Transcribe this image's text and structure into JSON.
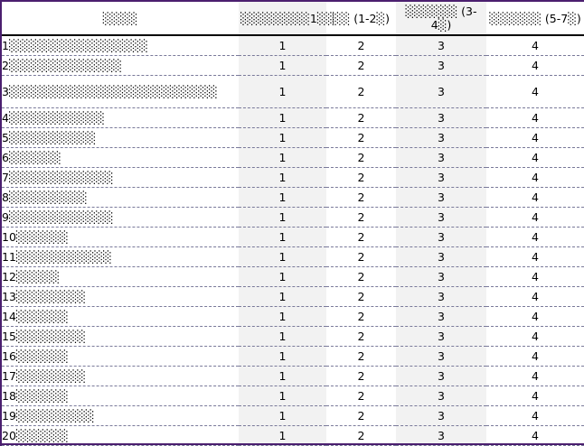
{
  "table": {
    "headers": [
      "░░░░",
      "░░░░░░░░1░░",
      "░░ (1-2░)",
      "░░░░░░ (3-4░)",
      "░░░░░░ (5-7░)"
    ],
    "rows": [
      {
        "label": "1░░░░░░░░░░░░░░░░",
        "values": [
          "1",
          "2",
          "3",
          "4"
        ]
      },
      {
        "label": "2░░░░░░░░░░░░░",
        "values": [
          "1",
          "2",
          "3",
          "4"
        ]
      },
      {
        "label": "3░░░░░░░░░░░░░░░░░░░░░░░░",
        "values": [
          "1",
          "2",
          "3",
          "4"
        ]
      },
      {
        "label": "4░░░░░░░░░░░",
        "values": [
          "1",
          "2",
          "3",
          "4"
        ]
      },
      {
        "label": "5░░░░░░░░░░",
        "values": [
          "1",
          "2",
          "3",
          "4"
        ]
      },
      {
        "label": "6░░░░░░",
        "values": [
          "1",
          "2",
          "3",
          "4"
        ]
      },
      {
        "label": "7░░░░░░░░░░░░",
        "values": [
          "1",
          "2",
          "3",
          "4"
        ]
      },
      {
        "label": "8░░░░░░░░░",
        "values": [
          "1",
          "2",
          "3",
          "4"
        ]
      },
      {
        "label": "9░░░░░░░░░░░░",
        "values": [
          "1",
          "2",
          "3",
          "4"
        ]
      },
      {
        "label": "10░░░░░░",
        "values": [
          "1",
          "2",
          "3",
          "4"
        ]
      },
      {
        "label": "11░░░░░░░░░░░",
        "values": [
          "1",
          "2",
          "3",
          "4"
        ]
      },
      {
        "label": "12░░░░░",
        "values": [
          "1",
          "2",
          "3",
          "4"
        ]
      },
      {
        "label": "13░░░░░░░░",
        "values": [
          "1",
          "2",
          "3",
          "4"
        ]
      },
      {
        "label": "14░░░░░░",
        "values": [
          "1",
          "2",
          "3",
          "4"
        ]
      },
      {
        "label": "15░░░░░░░░",
        "values": [
          "1",
          "2",
          "3",
          "4"
        ]
      },
      {
        "label": "16░░░░░░",
        "values": [
          "1",
          "2",
          "3",
          "4"
        ]
      },
      {
        "label": "17░░░░░░░░",
        "values": [
          "1",
          "2",
          "3",
          "4"
        ]
      },
      {
        "label": "18░░░░░░",
        "values": [
          "1",
          "2",
          "3",
          "4"
        ]
      },
      {
        "label": "19░░░░░░░░░",
        "values": [
          "1",
          "2",
          "3",
          "4"
        ]
      },
      {
        "label": "20░░░░░░",
        "values": [
          "1",
          "2",
          "3",
          "4"
        ]
      }
    ]
  },
  "colors": {
    "frame": "#4b1f6f",
    "shade": "#f2f2f2",
    "row_rule": "#7a7a9a"
  }
}
